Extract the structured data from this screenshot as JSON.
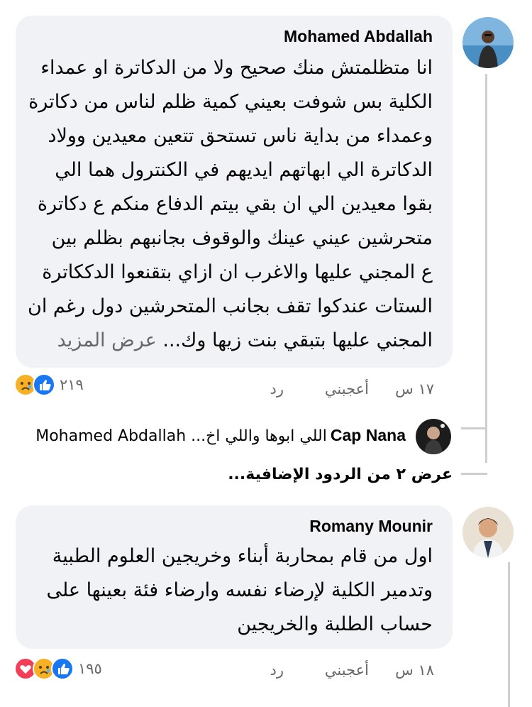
{
  "comments": [
    {
      "author": "Mohamed Abdallah",
      "lines": [
        "انا متظلمتش منك صحيح ولا من الدكاترة او عمداء",
        "الكلية بس شوفت بعيني كمية ظلم لناس من دكاترة",
        "وعمداء من بداية ناس تستحق تتعين معيدين وولاد",
        "الدكاترة الي ابهاتهم ايديهم في الكنترول هما الي",
        "بقوا معيدين الي ان بقي بيتم الدفاع منكم ع دكاترة",
        "متحرشين عيني عينك والوقوف بجانبهم بظلم بين",
        "ع المجني عليها والاغرب ان ازاي بتقنعوا الدككاترة",
        "الستات عندكوا تقف بجانب المتحرشين دول رغم ان",
        "المجني عليها بتبقي بنت زيها وك..."
      ],
      "see_more": "عرض المزيد",
      "time": "١٧ س",
      "like_label": "أعجبني",
      "reply_label": "رد",
      "reaction_count": "٢١٩",
      "reactions": [
        "sad",
        "like"
      ]
    },
    {
      "author": "Romany Mounir",
      "lines": [
        "اول من قام بمحاربة أبناء وخريجين العلوم الطبية",
        "وتدمير الكلية لإرضاء نفسه وارضاء فئة بعينها على",
        "حساب الطلبة والخريجين"
      ],
      "time": "١٨ س",
      "like_label": "أعجبني",
      "reply_label": "رد",
      "reaction_count": "١٩٥",
      "reactions": [
        "love",
        "sad",
        "like"
      ]
    }
  ],
  "reply_preview": {
    "author": "Cap Nana",
    "text": "Mohamed Abdallah ...اللي ابوها واللي اخ"
  },
  "view_more_replies": "عرض ٢ من الردود الإضافية...",
  "colors": {
    "bubble": "#f0f2f5",
    "like": "#1877f2",
    "sad": "#f7b125",
    "love": "#f33e58",
    "muted": "#65676b"
  }
}
